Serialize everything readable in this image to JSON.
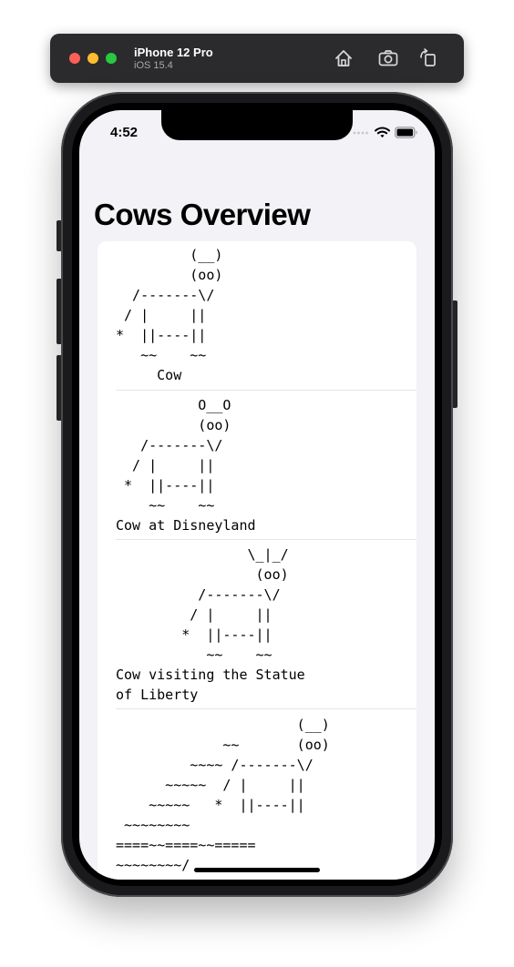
{
  "simulator": {
    "device_name": "iPhone 12 Pro",
    "os_version": "iOS 15.4",
    "buttons": [
      {
        "name": "home-icon"
      },
      {
        "name": "screenshot-icon"
      },
      {
        "name": "rotate-icon"
      }
    ]
  },
  "status_bar": {
    "time": "4:52",
    "icons": [
      "cellular-dots-icon",
      "wifi-icon",
      "battery-icon"
    ]
  },
  "navigation": {
    "large_title": "Cows Overview"
  },
  "cows": [
    {
      "art": "         (__)\n         (oo)\n  /-------\\/\n / |     ||\n*  ||----||\n   ~~    ~~\n     Cow"
    },
    {
      "art": "          O__O\n          (oo)\n   /-------\\/\n  / |     ||\n *  ||----||\n    ~~    ~~\nCow at Disneyland"
    },
    {
      "art": "                \\_|_/\n                 (oo)\n          /-------\\/\n         / |     ||\n        *  ||----||\n           ~~    ~~\nCow visiting the Statue\nof Liberty"
    },
    {
      "art": "                      (__)\n             ~~       (oo)\n         ~~~~ /-------\\/\n      ~~~~~  / |     ||\n    ~~~~~   *  ||----||\n ~~~~~~~~\n====~~====~~=====\n~~~~~~~~/"
    }
  ],
  "colors": {
    "background": "#f2f2f7",
    "card": "#ffffff",
    "separator": "#e5e5ea",
    "sim_bar": "#2b2b2d",
    "traffic_red": "#fe5f57",
    "traffic_yellow": "#febc2e",
    "traffic_green": "#28c840"
  }
}
